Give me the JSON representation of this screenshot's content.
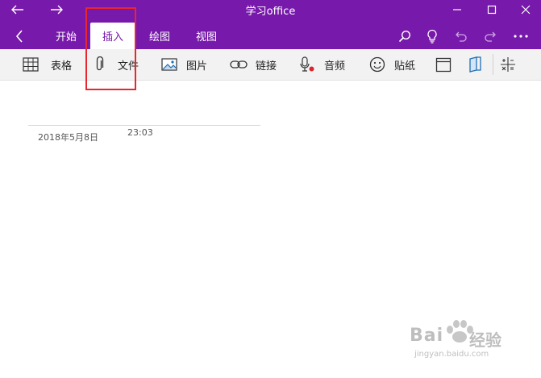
{
  "window": {
    "title": "学习office",
    "controls": [
      "back-icon",
      "forward-icon",
      "minimize-icon",
      "maximize-icon",
      "close-icon"
    ]
  },
  "ribbon": {
    "back_icon": "chevron-left-icon",
    "tabs": [
      {
        "label": "开始",
        "active": false
      },
      {
        "label": "插入",
        "active": true
      },
      {
        "label": "绘图",
        "active": false
      },
      {
        "label": "视图",
        "active": false
      }
    ],
    "right_icons": [
      "search-icon",
      "lightbulb-icon",
      "undo-icon",
      "redo-icon",
      "more-icon"
    ]
  },
  "toolbar": {
    "items": [
      {
        "label": "表格",
        "icon": "table-icon"
      },
      {
        "label": "文件",
        "icon": "paperclip-icon"
      },
      {
        "label": "图片",
        "icon": "picture-icon"
      },
      {
        "label": "链接",
        "icon": "link-icon"
      },
      {
        "label": "音频",
        "icon": "microphone-icon"
      },
      {
        "label": "贴纸",
        "icon": "sticker-icon"
      },
      {
        "label": "",
        "icon": "calendar-icon"
      },
      {
        "label": "",
        "icon": "notebook-icon"
      },
      {
        "label": "",
        "icon": "equation-icon"
      }
    ]
  },
  "page": {
    "date": "2018年5月8日",
    "time": "23:03"
  },
  "watermark": {
    "brand": "Bai",
    "brand_cn": "经验",
    "url": "jingyan.baidu.com"
  },
  "colors": {
    "accent": "#7719aa",
    "highlight": "#e8262d",
    "toolbar_bg": "#f2f2f2"
  }
}
